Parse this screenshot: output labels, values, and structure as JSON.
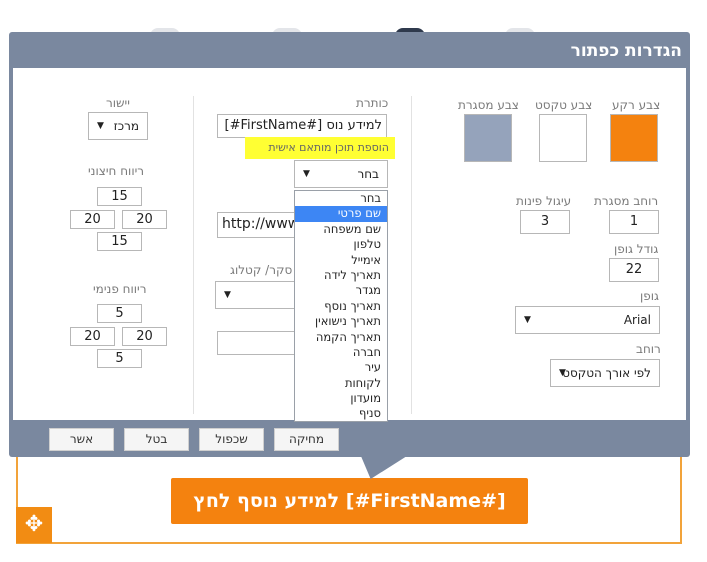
{
  "dialog": {
    "title": "הגדרות כפתור",
    "colors": {
      "background_color": "#f4820f",
      "text_color": "#ffffff",
      "border_color": "#95a3bb",
      "header": "#7a889f"
    }
  },
  "color_section": {
    "background_label": "צבע רקע",
    "text_label": "צבע טקסט",
    "border_label": "צבע מסגרת"
  },
  "border_width": {
    "label": "רוחב מסגרת",
    "value": "1"
  },
  "corner_radius": {
    "label": "עיגול פינות",
    "value": "3"
  },
  "font_size": {
    "label": "גודל גופן",
    "value": "22"
  },
  "font": {
    "label": "גופן",
    "value": "Arial"
  },
  "width": {
    "label": "רוחב",
    "value": "לפי אורך הטקסט"
  },
  "title_field": {
    "label": "כותרת",
    "value": "[#FirstName#] למידע נוס",
    "hint": "הוספת תוכן מותאם אישית"
  },
  "personalize_select": {
    "value": "בחר",
    "options": [
      "בחר",
      "שם פרטי",
      "שם משפחה",
      "טלפון",
      "אימייל",
      "תאריך לידה",
      "מגדר",
      "תאריך נוסף",
      "תאריך נישואין",
      "תאריך הקמה",
      "חברה",
      "עיר",
      "לקוחות",
      "מועדון",
      "סניף"
    ],
    "highlighted_index": 1
  },
  "link_field": {
    "value": "http://www."
  },
  "catalog": {
    "label": "סקר/ קטלוג"
  },
  "alignment": {
    "label": "יישור",
    "value": "מרכז"
  },
  "outer_padding": {
    "label": "ריווח חיצוני",
    "top": "15",
    "right": "20",
    "left": "20",
    "bottom": "15"
  },
  "inner_padding": {
    "label": "ריווח פנימי",
    "top": "5",
    "right": "20",
    "left": "20",
    "bottom": "5"
  },
  "footer": {
    "delete": "מחיקה",
    "duplicate": "שכפול",
    "cancel": "בטל",
    "confirm": "אשר"
  },
  "button_preview": {
    "text": "[#FirstName#] למידע נוסף לחץ"
  }
}
